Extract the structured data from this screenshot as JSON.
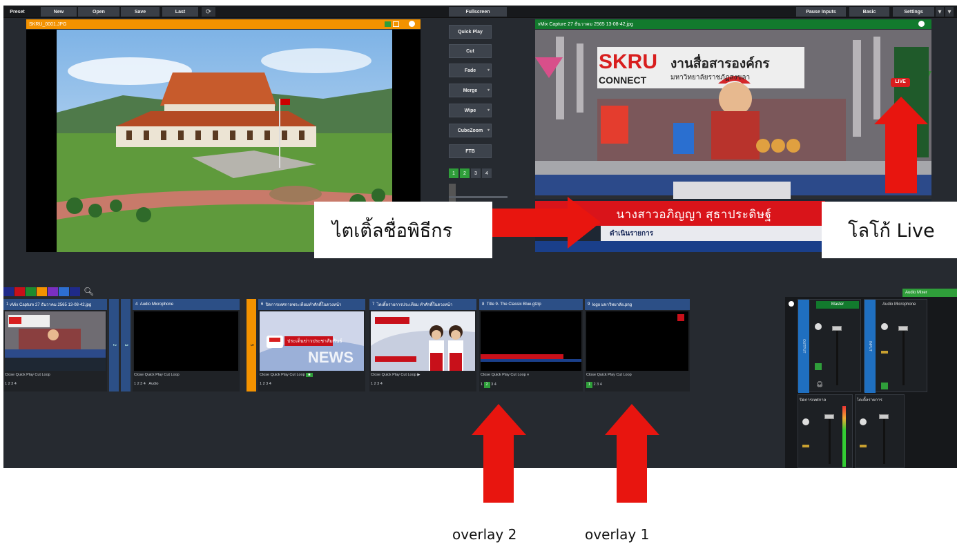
{
  "colors": {
    "accent_orange": "#f39200",
    "preview_green": "#127a2d",
    "input_blue": "#2c4f86",
    "arrow_red": "#e8150f"
  },
  "toolbar": {
    "preset": "Preset",
    "new": "New",
    "open": "Open",
    "save": "Save",
    "last": "Last",
    "refresh_icon": "refresh-icon",
    "fullscreen": "Fullscreen",
    "pause_inputs": "Pause Inputs",
    "basic": "Basic",
    "settings": "Settings"
  },
  "preview": {
    "title": "SKRU_0001.JPG"
  },
  "output": {
    "title": "vMix Capture 27 ธันวาคม 2565 13-08-42.jpg",
    "scene_title_1": "SKRU",
    "scene_title_2": "งานสื่อสารองค์กร",
    "scene_title_3": "CONNECT",
    "scene_title_4": "มหาวิทยาลัยราชภัฏสงขลา",
    "name_bar": "นางสาวอภิญญา สุธาประดิษฐ์",
    "name_sub": "ดำเนินรายการ",
    "live_badge": "LIVE"
  },
  "transitions": {
    "quick_play": "Quick Play",
    "cut": "Cut",
    "fade": "Fade",
    "merge": "Merge",
    "wipe": "Wipe",
    "cube_zoom": "CubeZoom",
    "ftb": "FTB",
    "numbers": [
      "1",
      "2",
      "3",
      "4"
    ]
  },
  "inputs": {
    "search_icon": "search-icon",
    "items": [
      {
        "num": "1",
        "title": "vMix Capture 27 ธันวาคม 2565 13-08-42.jpg",
        "controls": "Close Quick Play Cut Loop"
      },
      {
        "num": "2",
        "title": "",
        "controls": ""
      },
      {
        "num": "3",
        "title": "",
        "controls": ""
      },
      {
        "num": "4",
        "title": "Audio Microphone",
        "controls": "Close Quick Play Cut Loop"
      },
      {
        "num": "5",
        "title": "",
        "controls": ""
      },
      {
        "num": "6",
        "title": "ปิดการเทศกาลพระเทียมทำศักดิ์ในดวงหน้า",
        "controls": "Close Quick Play Cut Loop"
      },
      {
        "num": "7",
        "title": "ไตเติ้ลรายการประเทียม ทำศักดิ์ในดวงหน้า",
        "controls": "Close Quick Play Cut Loop"
      },
      {
        "num": "8",
        "title": "Title 9- The Classic Blue.gtzip",
        "controls": "Close Quick Play Cut Loop"
      },
      {
        "num": "9",
        "title": "logo มหาวิทยาลัย.png",
        "controls": "Close Quick Play Cut Loop"
      }
    ],
    "news_text": "ประเด็นข่าวประชาสัมพันธ์",
    "news_big": "NEWS",
    "nums_row": "1 2 3 4",
    "audio_label": "Audio"
  },
  "audio": {
    "header": "Audio Mixer",
    "master": "Master",
    "mic": "Audio Microphone",
    "mixer_c": "ปิดการเทศกาล",
    "mixer_f": "ไตเติ้ลรายการ",
    "strip_left": "OUTPUT",
    "strip_right": "INPUT"
  },
  "annotations": {
    "callout_title": "ไตเติ้ลชื่อพิธีกร",
    "callout_logo": "โลโก้ Live",
    "overlay2": "overlay 2",
    "overlay1": "overlay 1"
  }
}
